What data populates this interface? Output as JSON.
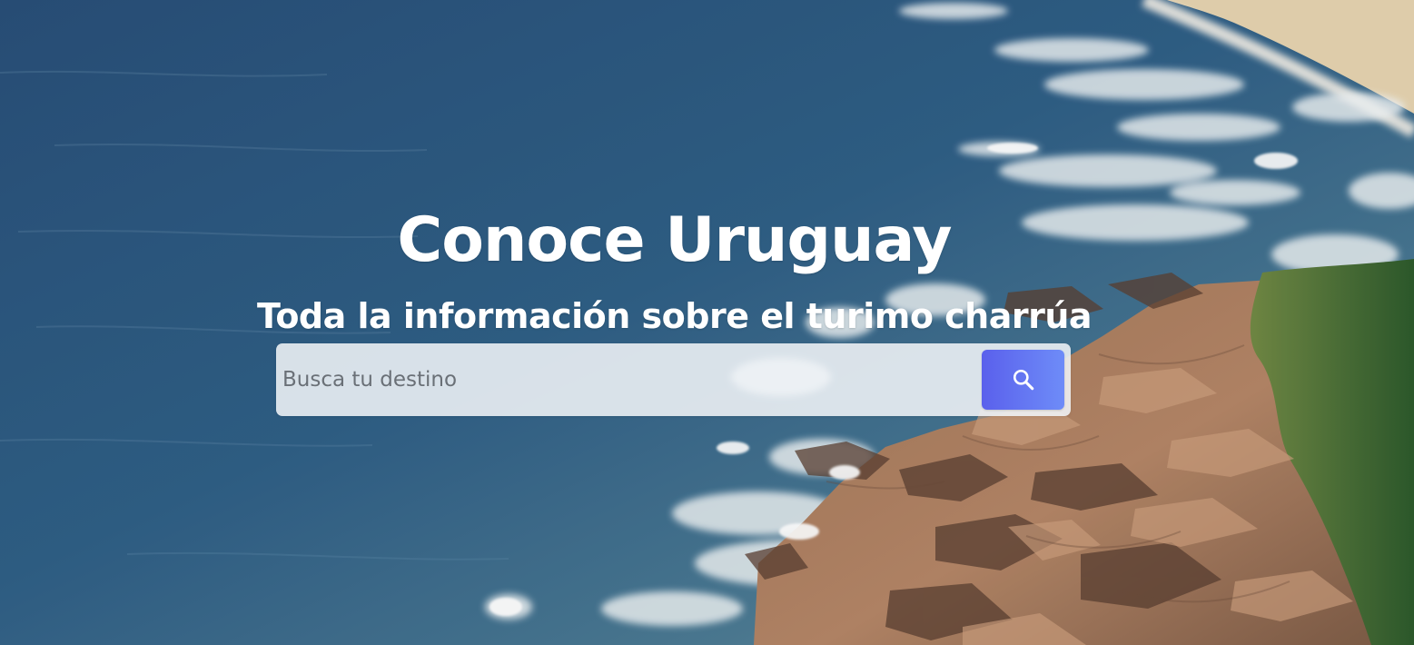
{
  "hero": {
    "title": "Conoce Uruguay",
    "subtitle": "Toda la información sobre el turimo charrúa"
  },
  "search": {
    "placeholder": "Busca tu destino",
    "value": "",
    "button_icon": "search-icon"
  },
  "colors": {
    "ocean": "#2f5a80",
    "sand": "#e8d6b5",
    "rocks": "#a5795a",
    "vegetation": "#4c7b3a",
    "search_button": "#6168ef"
  }
}
